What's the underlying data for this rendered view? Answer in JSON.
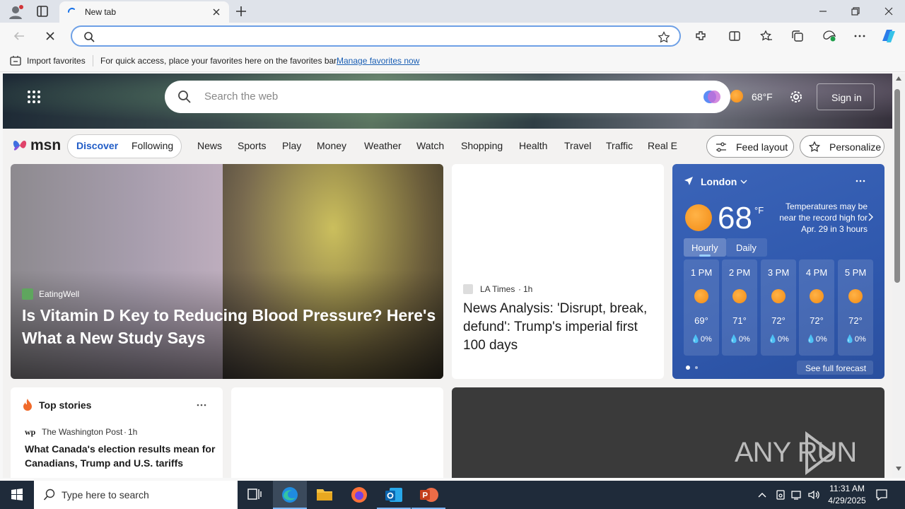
{
  "browser": {
    "tab_title": "New tab",
    "favbar": {
      "import_label": "Import favorites",
      "hint": "For quick access, place your favorites here on the favorites bar.",
      "manage_link": "Manage favorites now"
    }
  },
  "msn": {
    "header": {
      "search_placeholder": "Search the web",
      "temp": "68°F",
      "signin_label": "Sign in"
    },
    "nav": {
      "logo": "msn",
      "discover": "Discover",
      "following": "Following",
      "items": [
        "News",
        "Sports",
        "Play",
        "Money",
        "Weather",
        "Watch",
        "Shopping",
        "Health",
        "Travel",
        "Traffic",
        "Real E"
      ],
      "feed_layout": "Feed layout",
      "personalize": "Personalize"
    },
    "hero_story": {
      "source": "EatingWell",
      "title": "Is Vitamin D Key to Reducing Blood Pressure? Here's What a New Study Says"
    },
    "story2": {
      "source": "LA Times",
      "age": "1h",
      "title": "News Analysis: 'Disrupt, break, defund': Trump's imperial first 100 days"
    },
    "weather": {
      "city": "London",
      "temp": "68",
      "unit": "°F",
      "alert": "Temperatures may be near the record high for Apr. 29 in 3 hours",
      "tab_hourly": "Hourly",
      "tab_daily": "Daily",
      "hours": [
        {
          "time": "1 PM",
          "temp": "69°",
          "precip": "0%"
        },
        {
          "time": "2 PM",
          "temp": "71°",
          "precip": "0%"
        },
        {
          "time": "3 PM",
          "temp": "72°",
          "precip": "0%"
        },
        {
          "time": "4 PM",
          "temp": "72°",
          "precip": "0%"
        },
        {
          "time": "5 PM",
          "temp": "72°",
          "precip": "0%"
        }
      ],
      "see_full": "See full forecast"
    },
    "top_stories": {
      "heading": "Top stories",
      "source": "The Washington Post",
      "age": "1h",
      "title": "What Canada's election results mean for Canadians, Trump and U.S. tariffs"
    },
    "watermark": "ANY RUN"
  },
  "taskbar": {
    "search_placeholder": "Type here to search",
    "time": "11:31 AM",
    "date": "4/29/2025"
  }
}
